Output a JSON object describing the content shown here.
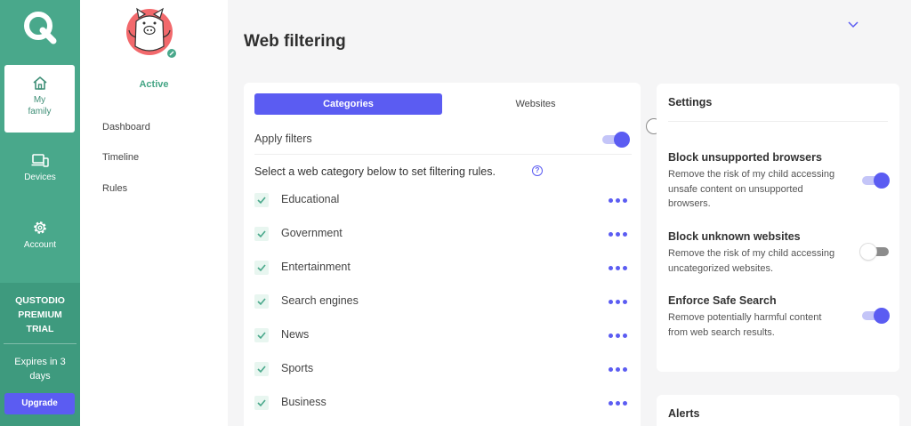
{
  "rail": {
    "items": [
      {
        "label_line1": "My",
        "label_line2": "family",
        "icon": "home-icon"
      },
      {
        "label": "Devices",
        "icon": "devices-icon"
      },
      {
        "label": "Account",
        "icon": "gear-icon"
      }
    ],
    "trial_line1": "QUSTODIO",
    "trial_line2": "PREMIUM",
    "trial_line3": "TRIAL",
    "expires_line1": "Expires in 3",
    "expires_line2": "days",
    "upgrade": "Upgrade"
  },
  "profile": {
    "status": "Active",
    "nav": [
      "Dashboard",
      "Timeline",
      "Rules"
    ]
  },
  "page": {
    "title": "Web filtering"
  },
  "filters": {
    "tabs": [
      "Categories",
      "Websites"
    ],
    "apply_label": "Apply filters",
    "apply_on": true,
    "select_text": "Select a web category below to set filtering rules.",
    "help_glyph": "?",
    "categories": [
      "Educational",
      "Government",
      "Entertainment",
      "Search engines",
      "News",
      "Sports",
      "Business"
    ]
  },
  "settings": {
    "title": "Settings",
    "items": [
      {
        "title": "Block unsupported browsers",
        "desc_lines": [
          "Remove the risk of my child accessing",
          "unsafe content on unsupported",
          "browsers."
        ],
        "on": true
      },
      {
        "title": "Block unknown websites",
        "desc_lines": [
          "Remove the risk of my child accessing",
          "uncategorized websites."
        ],
        "on": false
      },
      {
        "title": "Enforce Safe Search",
        "desc_lines": [
          "Remove potentially harmful content",
          "from web search results."
        ],
        "on": true
      }
    ]
  },
  "alerts": {
    "title": "Alerts"
  },
  "colors": {
    "rail": "#49a88b",
    "accent": "#5b5cf2",
    "active_text": "#45a585"
  }
}
